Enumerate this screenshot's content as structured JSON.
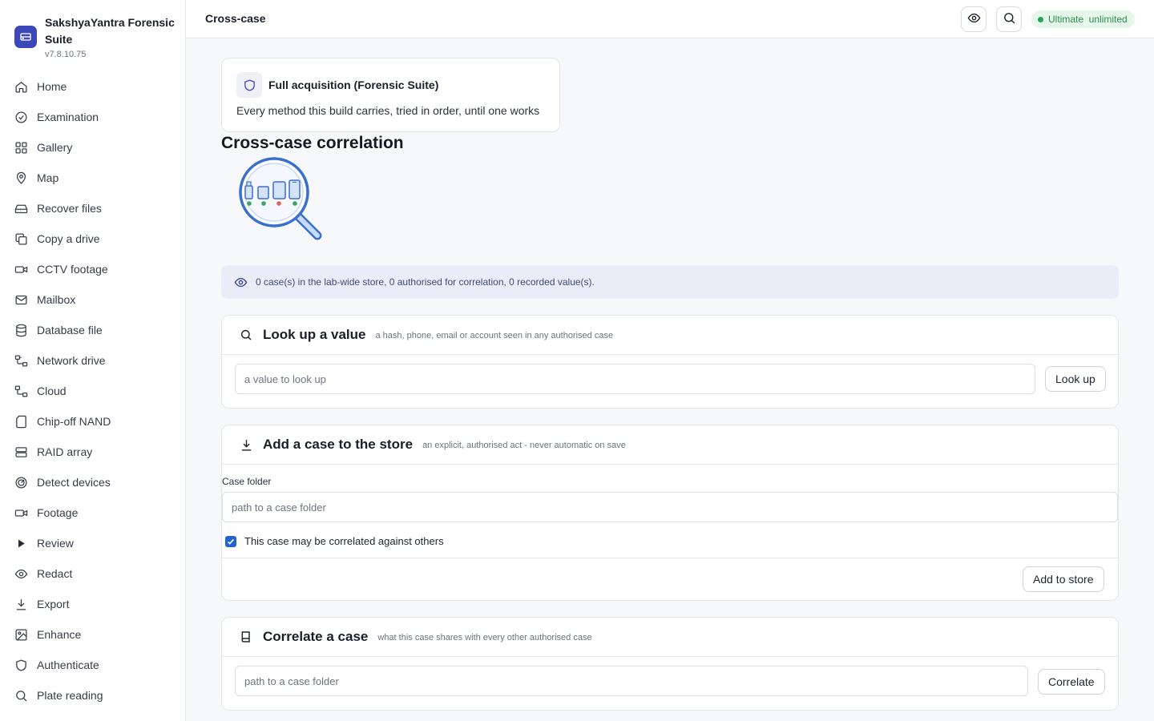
{
  "app": {
    "name": "SakshyaYantra Forensic Suite",
    "version": "v7.8.10.75"
  },
  "sidebar": {
    "items": [
      {
        "label": "Home",
        "icon": "home-icon"
      },
      {
        "label": "Examination",
        "icon": "check-circle-icon"
      },
      {
        "label": "Gallery",
        "icon": "grid-icon"
      },
      {
        "label": "Map",
        "icon": "map-pin-icon"
      },
      {
        "label": "Recover files",
        "icon": "hard-drive-icon"
      },
      {
        "label": "Copy a drive",
        "icon": "copy-icon"
      },
      {
        "label": "CCTV footage",
        "icon": "video-camera-icon"
      },
      {
        "label": "Mailbox",
        "icon": "mail-icon"
      },
      {
        "label": "Database file",
        "icon": "database-icon"
      },
      {
        "label": "Network drive",
        "icon": "network-icon"
      },
      {
        "label": "Cloud",
        "icon": "cloud-network-icon"
      },
      {
        "label": "Chip-off NAND",
        "icon": "sd-card-icon"
      },
      {
        "label": "RAID array",
        "icon": "server-icon"
      },
      {
        "label": "Detect devices",
        "icon": "radar-icon"
      },
      {
        "label": "Footage",
        "icon": "video-icon"
      },
      {
        "label": "Review",
        "icon": "play-icon"
      },
      {
        "label": "Redact",
        "icon": "eye-icon"
      },
      {
        "label": "Export",
        "icon": "download-icon"
      },
      {
        "label": "Enhance",
        "icon": "image-icon"
      },
      {
        "label": "Authenticate",
        "icon": "shield-icon"
      },
      {
        "label": "Plate reading",
        "icon": "search-icon"
      }
    ]
  },
  "header": {
    "title": "Cross-case",
    "license": "Ultimate  unlimited"
  },
  "mode_card": {
    "title": "Full acquisition (Forensic Suite)",
    "description": "Every method this build carries, tried in order, until one works"
  },
  "section": {
    "title": "Cross-case correlation"
  },
  "info": {
    "text": "0 case(s) in the lab-wide store, 0 authorised for correlation, 0 recorded value(s)."
  },
  "lookup": {
    "title": "Look up a value",
    "subtitle": "a hash, phone, email or account seen in any authorised case",
    "placeholder": "a value to look up",
    "button": "Look up"
  },
  "add_case": {
    "title": "Add a case to the store",
    "subtitle": "an explicit, authorised act - never automatic on save",
    "field_label": "Case folder",
    "placeholder": "path to a case folder",
    "checkbox_label": "This case may be correlated against others",
    "checked": true,
    "button": "Add to store"
  },
  "correlate": {
    "title": "Correlate a case",
    "subtitle": "what this case shares with every other authorised case",
    "placeholder": "path to a case folder",
    "button": "Correlate"
  },
  "colors": {
    "accent": "#3b48b8",
    "success": "#29a357",
    "info_bg": "#eaedf7",
    "checkbox": "#2463d6"
  }
}
